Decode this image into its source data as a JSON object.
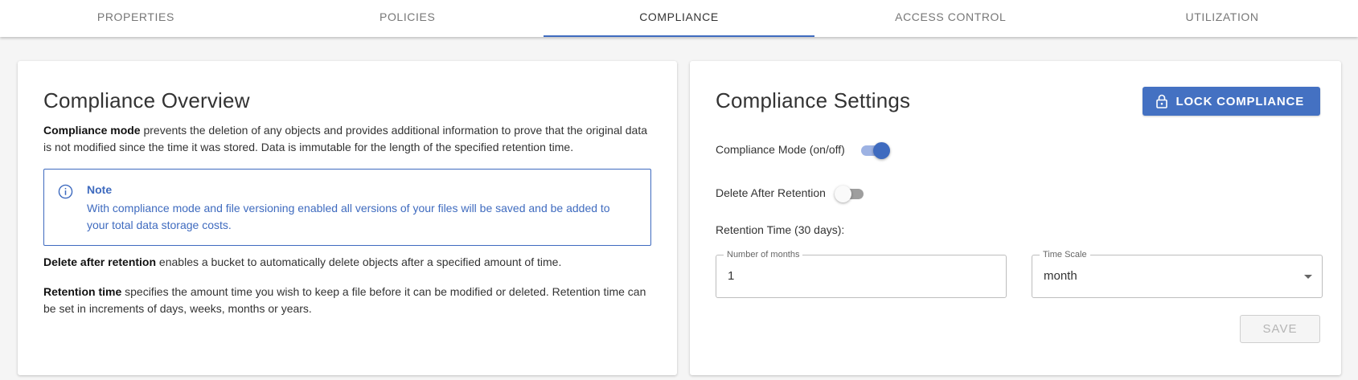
{
  "tabs": [
    {
      "label": "PROPERTIES",
      "active": false
    },
    {
      "label": "POLICIES",
      "active": false
    },
    {
      "label": "COMPLIANCE",
      "active": true
    },
    {
      "label": "ACCESS CONTROL",
      "active": false
    },
    {
      "label": "UTILIZATION",
      "active": false
    }
  ],
  "overview": {
    "title": "Compliance Overview",
    "p1_bold": "Compliance mode",
    "p1_text": " prevents the deletion of any objects and provides additional information to prove that the original data is not modified since the time it was stored. Data is immutable for the length of the specified retention time.",
    "note_title": "Note",
    "note_body": "With compliance mode and file versioning enabled all versions of your files will be saved and be added to your total data storage costs.",
    "p2_bold": "Delete after retention",
    "p2_text": " enables a bucket to automatically delete objects after a specified amount of time.",
    "p3_bold": "Retention time",
    "p3_text": " specifies the amount time you wish to keep a file before it can be modified or deleted. Retention time can be set in increments of days, weeks, months or years."
  },
  "settings": {
    "title": "Compliance Settings",
    "lock_button": "LOCK COMPLIANCE",
    "compliance_mode_label": "Compliance Mode (on/off)",
    "compliance_mode_on": true,
    "delete_after_label": "Delete After Retention",
    "delete_after_on": false,
    "retention_label": "Retention Time (30 days):",
    "months_field_label": "Number of months",
    "months_value": "1",
    "scale_field_label": "Time Scale",
    "scale_value": "month",
    "save_button": "SAVE"
  },
  "colors": {
    "accent": "#3f6bbf",
    "button_bg": "#4471c2"
  },
  "icons": {
    "note": "info-icon",
    "lock": "lock-icon",
    "select": "chevron-down-icon"
  }
}
